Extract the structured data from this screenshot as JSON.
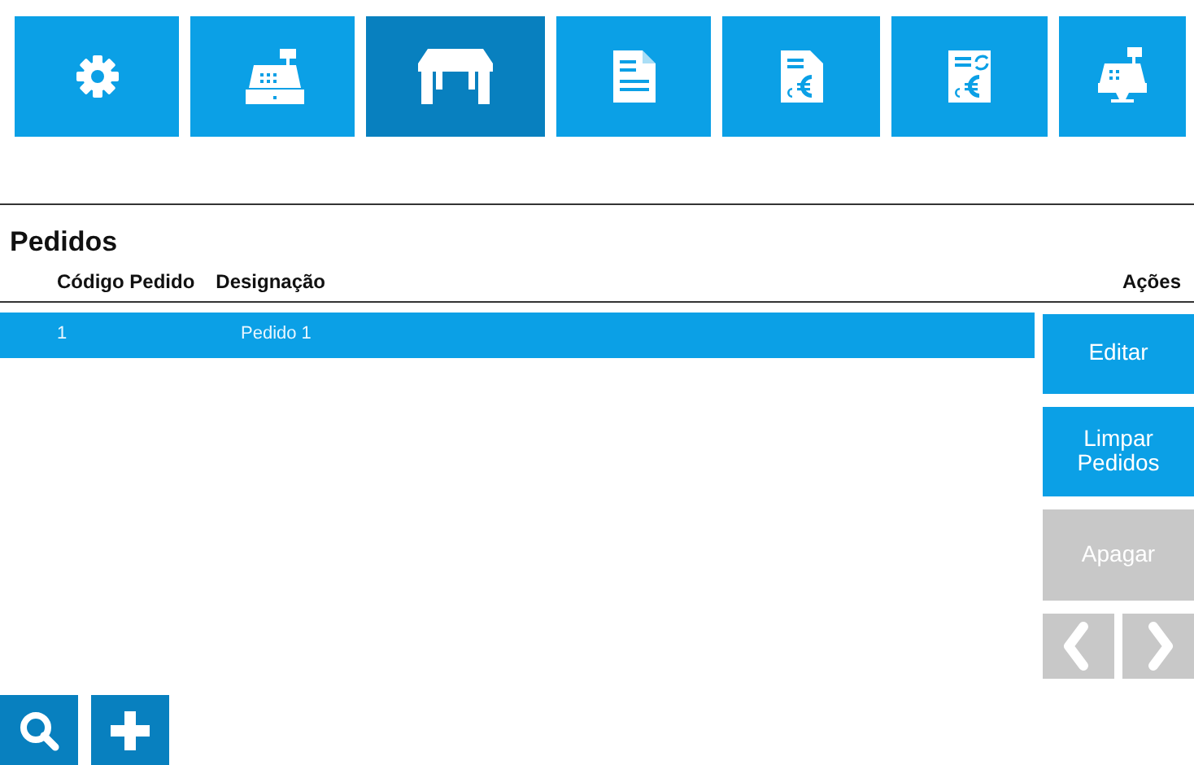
{
  "toolbar": [
    {
      "kind": "gear",
      "selected": false
    },
    {
      "kind": "register",
      "selected": false
    },
    {
      "kind": "table",
      "selected": true
    },
    {
      "kind": "document",
      "selected": false
    },
    {
      "kind": "invoice",
      "selected": false
    },
    {
      "kind": "invoice-sync",
      "selected": false
    },
    {
      "kind": "register-stand",
      "selected": false
    }
  ],
  "section_title": "Pedidos",
  "table": {
    "columns": [
      "Código Pedido",
      "Designação"
    ],
    "actions_header": "Ações",
    "rows": [
      {
        "cells": [
          "1",
          "Pedido 1"
        ],
        "selected": true
      }
    ]
  },
  "actions": [
    {
      "label": "Editar",
      "disabled": false
    },
    {
      "label": "Limpar Pedidos",
      "disabled": false
    },
    {
      "label": "Apagar",
      "disabled": true
    }
  ],
  "pager": [
    {
      "kind": "prev",
      "disabled": true
    },
    {
      "kind": "next",
      "disabled": true
    }
  ],
  "bottom_buttons": [
    {
      "kind": "search"
    },
    {
      "kind": "add"
    }
  ]
}
